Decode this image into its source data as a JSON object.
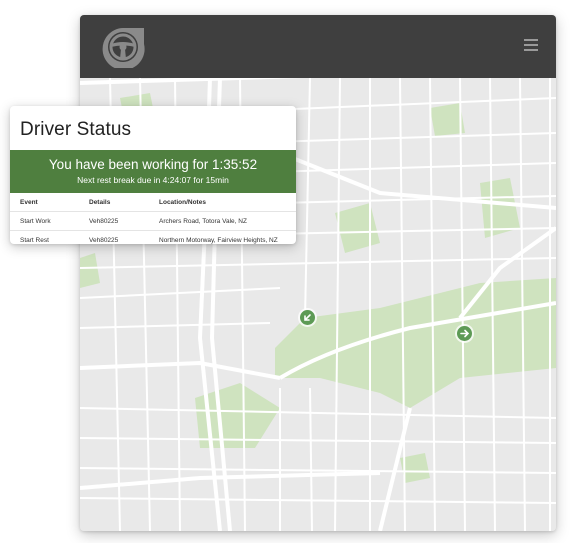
{
  "header": {
    "logo_icon": "steering-wheel-icon",
    "menu_icon": "hamburger-menu-icon",
    "background": "#3f3f3f"
  },
  "map": {
    "background": "#e9e9e9",
    "park_color": "#cfe3bf",
    "road_color": "#ffffff",
    "pins": [
      {
        "icon": "arrow-down-left-icon",
        "color": "#5d9a55"
      },
      {
        "icon": "arrow-right-icon",
        "color": "#5d9a55"
      }
    ]
  },
  "driver_status": {
    "title": "Driver Status",
    "banner": {
      "main": "You have been working for 1:35:52",
      "sub": "Next rest break due in 4:24:07 for 15min",
      "color": "#4f7f3f"
    },
    "table": {
      "headers": [
        "Event",
        "Details",
        "Location/Notes"
      ],
      "rows": [
        [
          "Start Work",
          "Veh80225",
          "Archers Road, Totora Vale, NZ"
        ],
        [
          "Start Rest",
          "Veh80225",
          "Northern Motorway, Fairview Heights, NZ"
        ]
      ]
    }
  }
}
